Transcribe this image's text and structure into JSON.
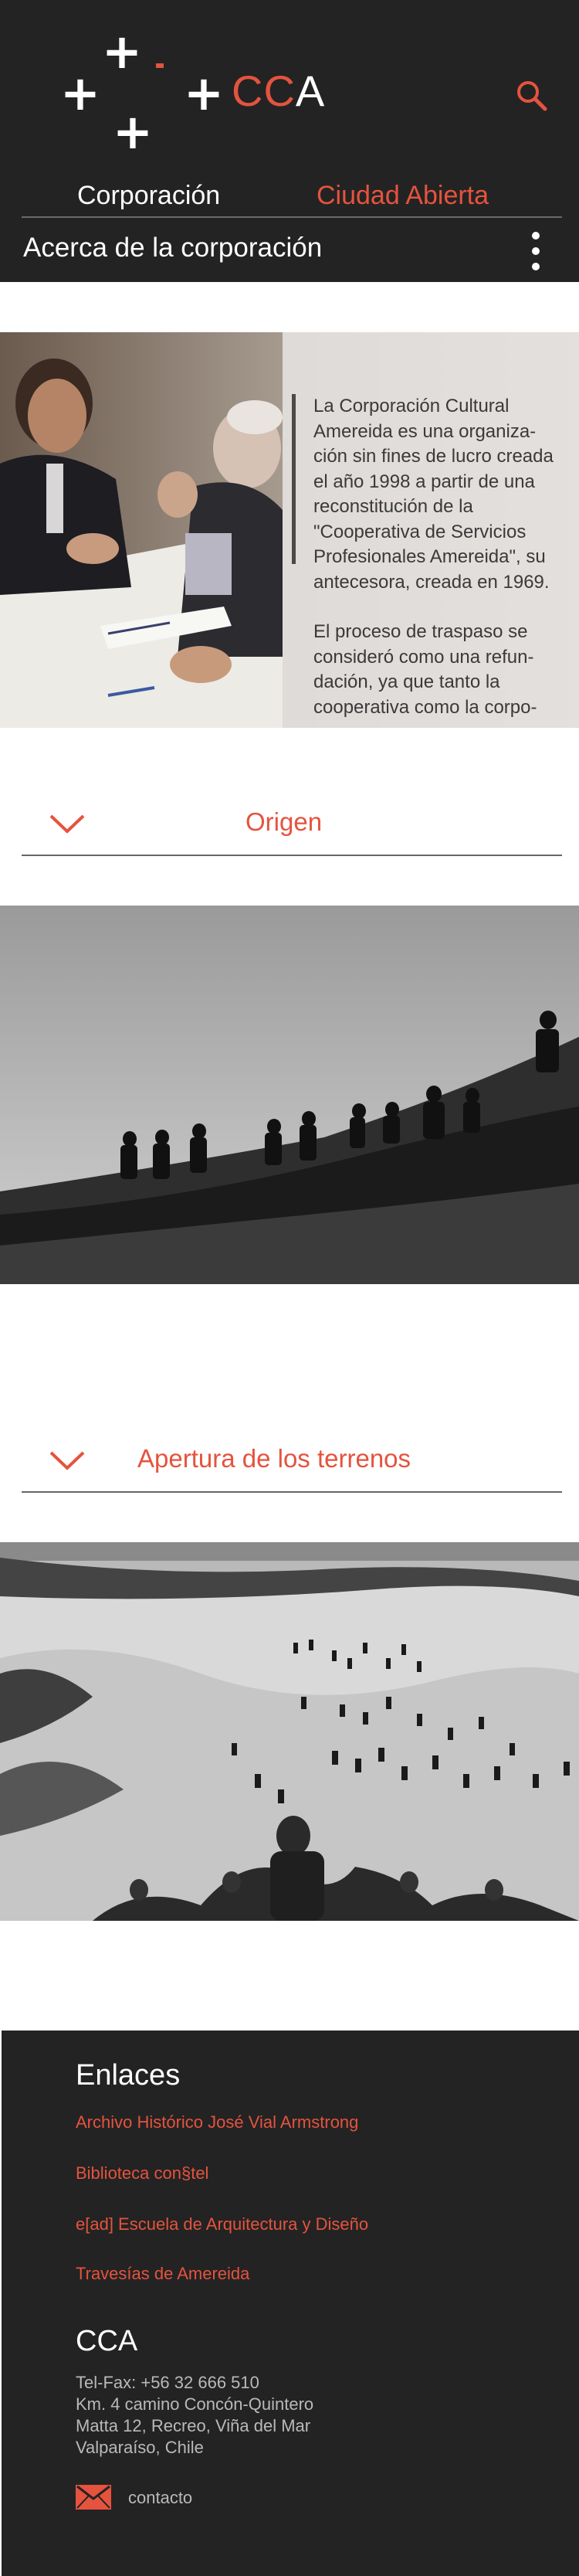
{
  "header": {
    "logo": {
      "wordmark_c1": "C",
      "wordmark_c2": "C",
      "wordmark_a": "A"
    },
    "nav": {
      "corporacion": "Corporación",
      "ciudad_abierta": "Ciudad Abierta"
    },
    "subnav_title": "Acerca de la corporación",
    "icons": {
      "search": "search-icon",
      "menu": "vertical-dots-icon"
    }
  },
  "hero": {
    "paragraphs": [
      "La Corporación Cultural Amereida es una organiza-ción sin fines de lucro creada el año 1998 a partir de una reconstitución de la \"Cooperativa de Servicios Profesionales Amereida\", su antecesora, creada en 1969.",
      "El proceso de traspaso se consideró como una refun-dación, ya que tanto la cooperativa como la corpo-"
    ]
  },
  "sections": [
    {
      "label": "Origen",
      "icon": "chevron-down-icon"
    },
    {
      "label": "Apertura de los terrenos",
      "icon": "chevron-down-icon"
    }
  ],
  "footer": {
    "links_title": "Enlaces",
    "links": [
      "Archivo Histórico José Vial Armstrong",
      "Biblioteca con§tel",
      "e[ad] Escuela de Arquitectura y Diseño",
      "Travesías de Amereida"
    ],
    "org_title": "CCA",
    "info": [
      "Tel-Fax: +56 32 666 510",
      "Km. 4 camino Concón-Quintero",
      "Matta 12, Recreo, Viña del Mar",
      "Valparaíso, Chile"
    ],
    "contact_label": "contacto",
    "icons": {
      "mail": "mail-icon"
    }
  },
  "colors": {
    "accent": "#e5533e",
    "dark": "#232323",
    "white": "#ffffff",
    "footer_text": "#b9b9b9"
  }
}
